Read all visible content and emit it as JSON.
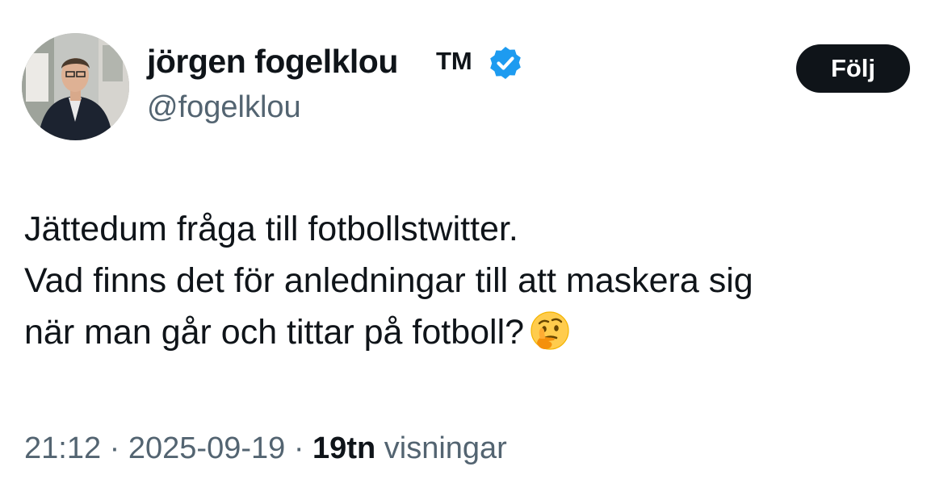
{
  "author": {
    "display_name": "jörgen fogelklou",
    "tm": "TM",
    "handle": "@fogelklou",
    "verified": true,
    "avatar_icon": "profile-photo"
  },
  "follow_button": {
    "label": "Följ"
  },
  "tweet": {
    "lines": [
      "Jättedum fråga till fotbollstwitter.",
      "Vad finns det för anledningar till att maskera sig",
      "när man går och tittar på fotboll?"
    ],
    "emoji": "thinking-face-icon"
  },
  "meta": {
    "time": "21:12",
    "separator": " · ",
    "date": "2025-09-19",
    "views_count": "19tn",
    "views_label": "visningar"
  },
  "colors": {
    "text": "#0f1419",
    "secondary": "#536471",
    "verified": "#1d9bf0",
    "button_bg": "#0f1419"
  }
}
